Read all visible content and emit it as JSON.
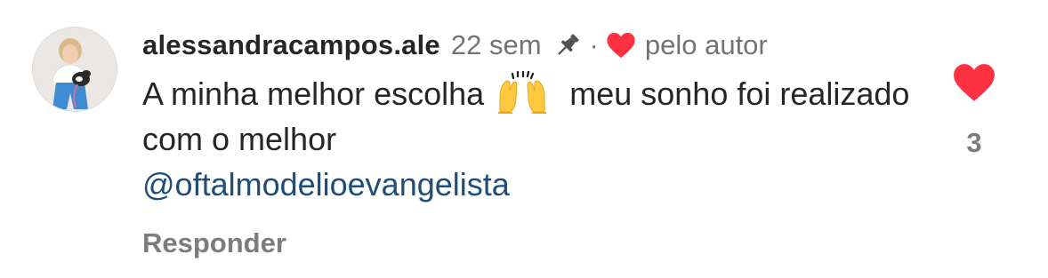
{
  "comment": {
    "username": "alessandracampos.ale",
    "time": "22 sem",
    "separator": "·",
    "liked_by_author_label": "pelo autor",
    "text_part1": "A minha melhor escolha",
    "text_part2": "meu sonho foi realizado com o melhor",
    "mention": "@oftalmodelioevangelista",
    "reply_label": "Responder",
    "like_count": "3",
    "icons": {
      "avatar": "profile-photo",
      "pin": "pin-icon",
      "author_heart": "heart-icon",
      "emoji": "raising-hands-emoji",
      "like": "heart-icon"
    },
    "colors": {
      "heart": "#ff3040",
      "mention": "#1e4d7a",
      "secondary_text": "#737373",
      "primary_text": "#262626"
    }
  }
}
